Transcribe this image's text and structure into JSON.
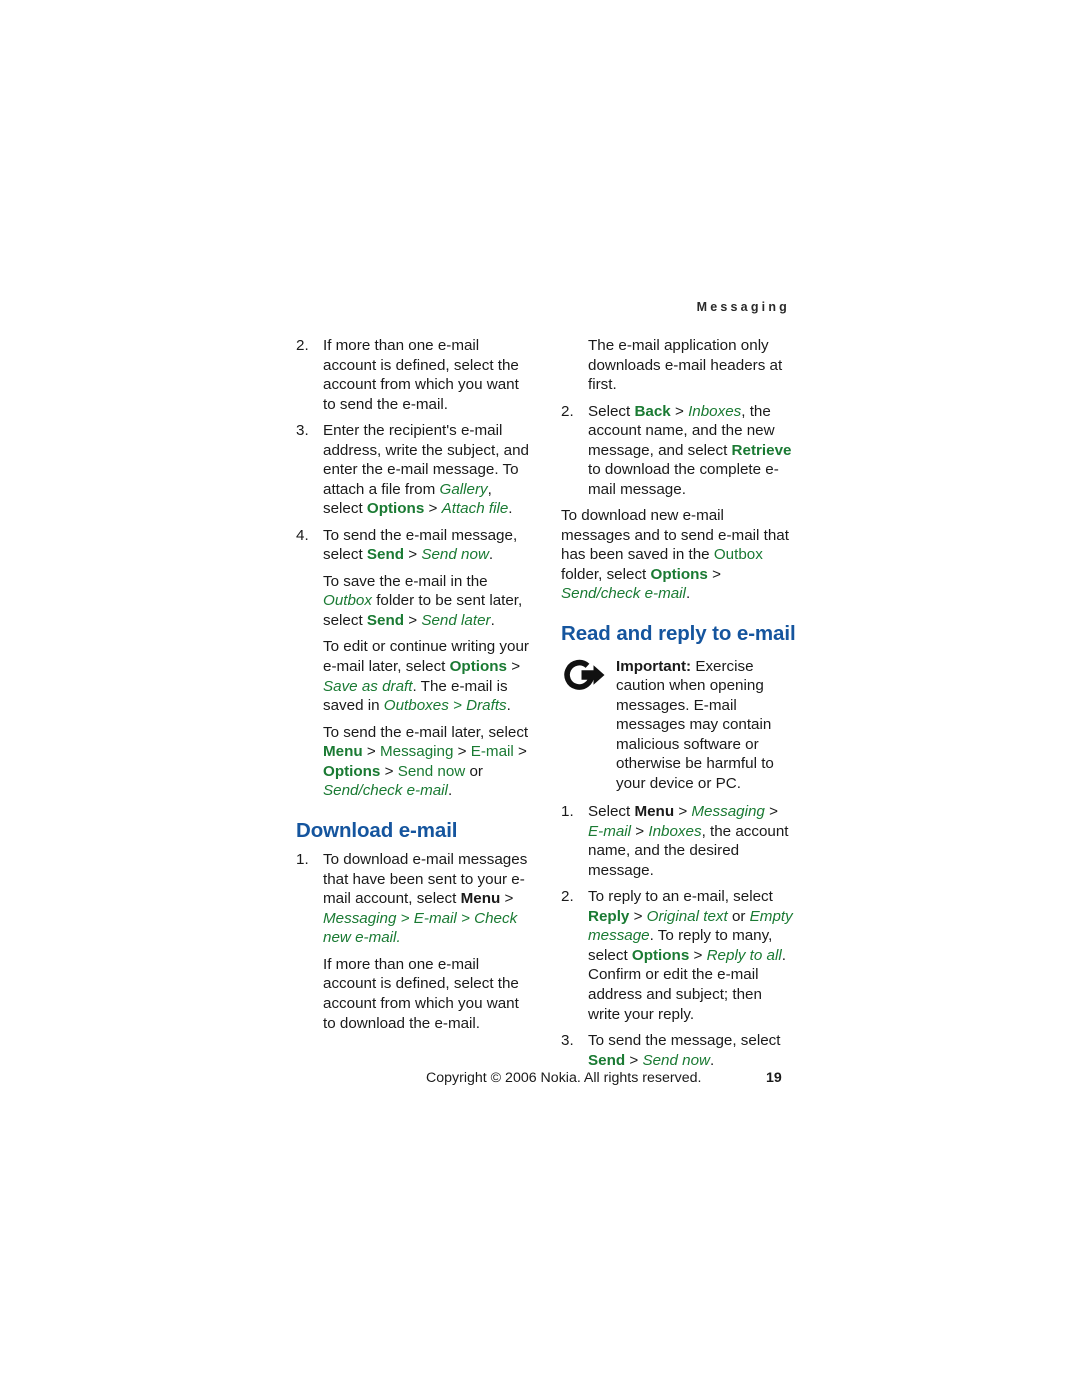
{
  "document": {
    "running_header": "Messaging",
    "page_number": "19",
    "copyright": "Copyright © 2006 Nokia. All rights reserved."
  },
  "colors": {
    "heading_blue": "#15559e",
    "ui_term_green": "#1a7a33",
    "body_black": "#1a1a1a"
  },
  "left_column": {
    "items": [
      {
        "number": "2.",
        "text": "If more than one e-mail account is defined, select the account from which you want to send the e-mail."
      },
      {
        "number": "3.",
        "text_part_1": "Enter the recipient's e-mail address, write the subject, and enter the e-mail message. To attach a file from ",
        "term_gallery": "Gallery",
        "text_part_2": ", select ",
        "term_options": "Options",
        "separator": " > ",
        "term_attach_file": "Attach file",
        "text_part_3": "."
      },
      {
        "number": "4.",
        "text_part_1": "To send the e-mail message, select ",
        "term_send": "Send",
        "separator": " > ",
        "term_send_now": "Send now",
        "text_part_2": "."
      }
    ],
    "para_save": {
      "text_part_1": "To save the e-mail in the ",
      "term_outbox": "Outbox",
      "text_part_2": " folder to be sent later, select ",
      "term_send": "Send",
      "separator": " > ",
      "term_send_later": "Send later",
      "text_part_3": "."
    },
    "para_edit": {
      "text_part_1": "To edit or continue writing your e-mail later, select ",
      "term_options": "Options",
      "separator_1": " > ",
      "term_save_as_draft": "Save as draft",
      "text_part_2": ". The e-mail is saved in ",
      "term_outboxes": "Outboxes",
      "separator_2": " > ",
      "term_drafts": "Drafts",
      "text_part_3": "."
    },
    "para_send_later": {
      "text_part_1": "To send the e-mail later, select ",
      "term_menu": "Menu",
      "separator_1": " > ",
      "term_messaging": "Messaging",
      "separator_2": " > ",
      "term_email": "E-mail",
      "separator_3": " > ",
      "term_options": "Options",
      "separator_4": " > ",
      "term_send_now": "Send now",
      "text_part_2": " or ",
      "term_send_check_email": "Send/check e-mail",
      "text_part_3": "."
    },
    "heading_download": "Download e-mail",
    "download_items": [
      {
        "number": "1.",
        "text_part_1": "To download e-mail messages that have been sent to your e-mail account, select ",
        "term_menu": "Menu",
        "separator_1": " > ",
        "term_messaging": "Messaging",
        "separator_2": " > ",
        "term_email": "E-mail",
        "separator_3": " > ",
        "term_check_new_email": "Check new e-mail",
        "text_part_2": "."
      }
    ],
    "para_more_accounts": "If more than one e-mail account is defined, select the account from which you want to download the e-mail."
  },
  "right_column": {
    "para_headers_first": "The e-mail application only downloads e-mail headers at first.",
    "items": [
      {
        "number": "2.",
        "text_part_1": "Select ",
        "term_back": "Back",
        "separator": " > ",
        "term_inboxes": "Inboxes",
        "text_part_2": ", the account name, and the new message, and select ",
        "term_retrieve": "Retrieve",
        "text_part_3": " to download the complete e-mail message."
      }
    ],
    "para_download_new": {
      "text_part_1": "To download new e-mail messages and to send e-mail that has been saved in the ",
      "term_outbox": "Outbox",
      "text_part_2": " folder, select ",
      "term_options": "Options",
      "separator": " > ",
      "term_send_check_email": "Send/check e-mail",
      "text_part_3": "."
    },
    "heading_read_reply": "Read and reply to e-mail",
    "note": {
      "icon": "important-arrow-icon",
      "label": "Important:",
      "text": " Exercise caution when opening messages. E-mail messages may contain malicious software or otherwise be harmful to your device or PC."
    },
    "reply_items": [
      {
        "number": "1.",
        "text_part_1": "Select ",
        "term_menu": "Menu",
        "separator_1": " > ",
        "term_messaging": "Messaging",
        "separator_2": " > ",
        "term_email": "E-mail",
        "separator_3": " > ",
        "term_inboxes": "Inboxes",
        "text_part_2": ", the account name, and the desired message."
      },
      {
        "number": "2.",
        "text_part_1": "To reply to an e-mail, select ",
        "term_reply": "Reply",
        "separator_1": " > ",
        "term_original_text": "Original text",
        "text_part_2": " or ",
        "term_empty_message": "Empty message",
        "text_part_3": ". To reply to many, select ",
        "term_options": "Options",
        "separator_2": " > ",
        "term_reply_to_all": "Reply to all",
        "text_part_4": ". Confirm or edit the e-mail address and subject; then write your reply."
      },
      {
        "number": "3.",
        "text_part_1": "To send the message, select ",
        "term_send": "Send",
        "separator": " > ",
        "term_send_now": "Send now",
        "text_part_2": "."
      }
    ]
  }
}
